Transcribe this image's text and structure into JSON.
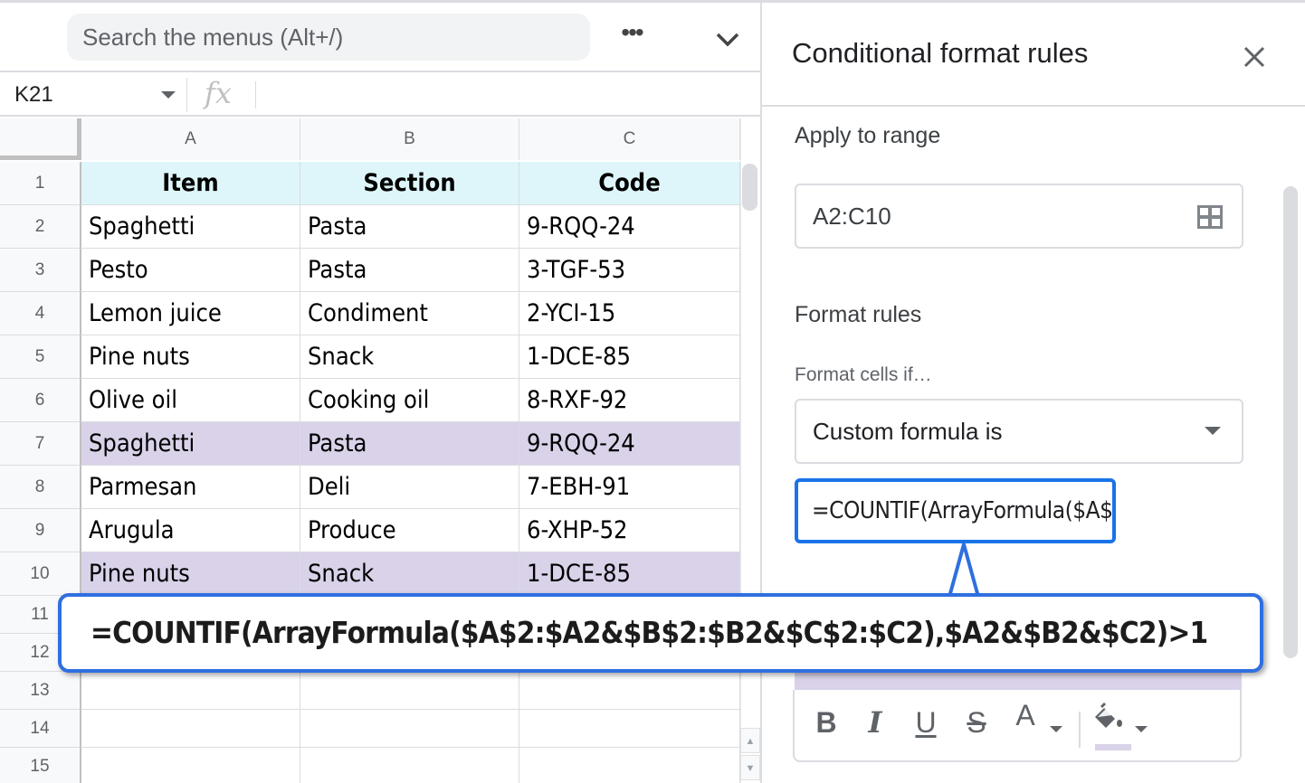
{
  "menubar": {
    "search_placeholder": "Search the menus (Alt+/)",
    "more_icon": "more-horiz-icon",
    "collapse_icon": "chevron-down-icon"
  },
  "formula_bar": {
    "name_box": "K21",
    "fx_label": "fx",
    "value": ""
  },
  "sheet": {
    "columns": [
      "A",
      "B",
      "C"
    ],
    "row_numbers": [
      "1",
      "2",
      "3",
      "4",
      "5",
      "6",
      "7",
      "8",
      "9",
      "10",
      "11",
      "12",
      "13",
      "14",
      "15"
    ],
    "header": [
      "Item",
      "Section",
      "Code"
    ],
    "rows": [
      {
        "cells": [
          "Spaghetti",
          "Pasta",
          "9-RQQ-24"
        ],
        "highlighted": false
      },
      {
        "cells": [
          "Pesto",
          "Pasta",
          "3-TGF-53"
        ],
        "highlighted": false
      },
      {
        "cells": [
          "Lemon juice",
          "Condiment",
          "2-YCI-15"
        ],
        "highlighted": false
      },
      {
        "cells": [
          "Pine nuts",
          "Snack",
          "1-DCE-85"
        ],
        "highlighted": false
      },
      {
        "cells": [
          "Olive oil",
          "Cooking oil",
          "8-RXF-92"
        ],
        "highlighted": false
      },
      {
        "cells": [
          "Spaghetti",
          "Pasta",
          "9-RQQ-24"
        ],
        "highlighted": true
      },
      {
        "cells": [
          "Parmesan",
          "Deli",
          "7-EBH-91"
        ],
        "highlighted": false
      },
      {
        "cells": [
          "Arugula",
          "Produce",
          "6-XHP-52"
        ],
        "highlighted": false
      },
      {
        "cells": [
          "Pine nuts",
          "Snack",
          "1-DCE-85"
        ],
        "highlighted": true
      }
    ],
    "header_fill": "#def6f9",
    "highlight_fill": "#d9d2e9"
  },
  "panel": {
    "title": "Conditional format rules",
    "close_icon": "close-icon",
    "apply_to_range_label": "Apply to range",
    "range_value": "A2:C10",
    "range_icon": "select-range-icon",
    "format_rules_label": "Format rules",
    "format_cells_if_label": "Format cells if…",
    "condition_selected": "Custom formula is",
    "formula_value": "=COUNTIF(ArrayFormula($A$2:$A2&$B$2:$B2&$C$2:$C2),$A2&$B2&$C2)>1",
    "formatting_style": {
      "fill_color": "#d9d2e9",
      "buttons": [
        "B",
        "I",
        "U",
        "S",
        "A"
      ]
    }
  },
  "callout": {
    "text": "=COUNTIF(ArrayFormula($A$2:$A2&$B$2:$B2&$C$2:$C2),$A2&$B2&$C2)>1",
    "border_color": "#2f6fe0"
  }
}
